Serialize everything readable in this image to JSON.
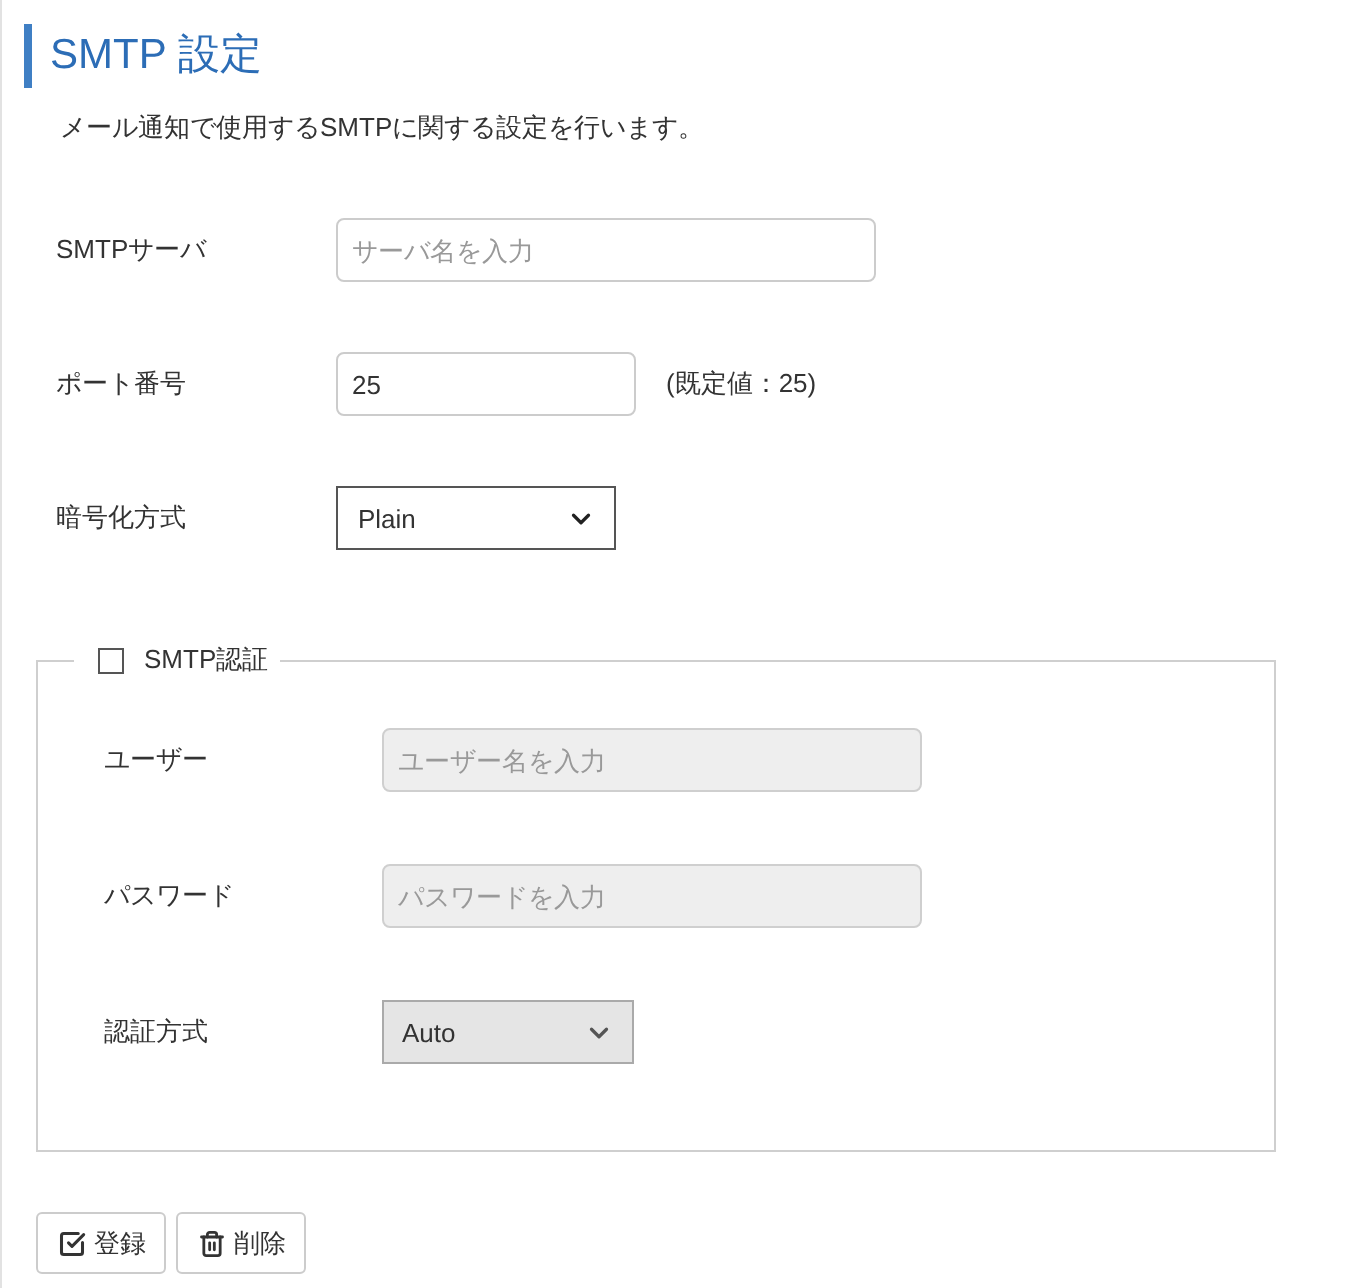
{
  "page": {
    "title": "SMTP 設定",
    "description": "メール通知で使用するSMTPに関する設定を行います。"
  },
  "fields": [
    {
      "kind": "text",
      "label": "SMTPサーバ",
      "placeholder": "サーバ名を入力",
      "disabled": false
    },
    {
      "kind": "number",
      "label": "ポート番号",
      "value": "25",
      "note": "(既定値：25)",
      "disabled": false
    },
    {
      "kind": "select",
      "label": "暗号化方式",
      "value": "Plain",
      "disabled": false
    }
  ],
  "auth": {
    "label": "SMTP認証",
    "checked": false,
    "fields": [
      {
        "kind": "text",
        "label": "ユーザー",
        "placeholder": "ユーザー名を入力",
        "disabled": true
      },
      {
        "kind": "text",
        "label": "パスワード",
        "placeholder": "パスワードを入力",
        "disabled": true
      },
      {
        "kind": "select",
        "label": "認証方式",
        "value": "Auto",
        "disabled": true
      }
    ]
  },
  "buttons": [
    {
      "kind": "register",
      "label": "登録"
    },
    {
      "kind": "delete",
      "label": "削除"
    }
  ]
}
